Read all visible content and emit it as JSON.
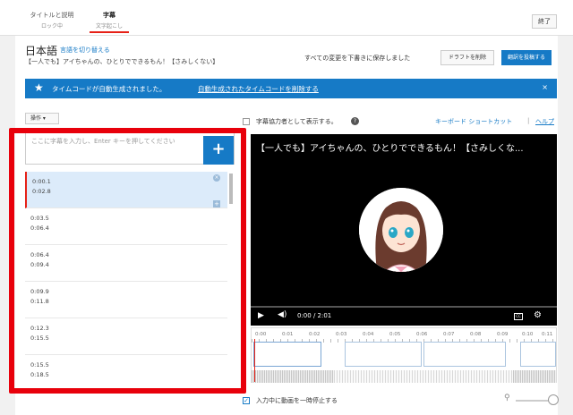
{
  "tabs": [
    {
      "label": "タイトルと説明",
      "sub": "ロック中"
    },
    {
      "label": "字幕",
      "sub": "文字起こし"
    }
  ],
  "finish_label": "終了",
  "language": {
    "title": "日本語",
    "switch_label": "言語を切り替える"
  },
  "video_title": "【一人でも】アイちゃんの、ひとりでできるもん！【さみしくない】",
  "save_status": "すべての変更を下書きに保存しました",
  "buttons": {
    "discard_draft": "ドラフトを削除",
    "publish": "翻訳を投稿する"
  },
  "banner": {
    "text": "タイムコードが自動生成されました。",
    "link": "自動生成されたタイムコードを削除する",
    "close": "×"
  },
  "ops_label": "操作 ▾",
  "caption_input": {
    "placeholder": "ここに字幕を入力し、Enter キーを押してください",
    "add_label": "+"
  },
  "captions": [
    {
      "start": "0:00.1",
      "end": "0:02.8"
    },
    {
      "start": "0:03.5",
      "end": "0:06.4"
    },
    {
      "start": "0:06.4",
      "end": "0:09.4"
    },
    {
      "start": "0:09.9",
      "end": "0:11.8"
    },
    {
      "start": "0:12.3",
      "end": "0:15.5"
    },
    {
      "start": "0:15.5",
      "end": "0:18.5"
    }
  ],
  "selected_caption_index": 0,
  "contributor_checkbox_label": "字幕協力者として表示する。",
  "keyboard_shortcuts_label": "キーボード ショートカット",
  "help_label": "ヘルプ",
  "player": {
    "caption_text": "【一人でも】アイちゃんの、ひとりでできるもん！【さみしくな...",
    "time": "0:00 / 2:01",
    "progress": 0
  },
  "timeline": {
    "ticks": [
      "0:00",
      "0:01",
      "0:02",
      "0:03",
      "0:04",
      "0:05",
      "0:06",
      "0:07",
      "0:08",
      "0:09",
      "0:10",
      "0:11"
    ]
  },
  "pause_checkbox_label": "入力中に動画を一時停止する",
  "colors": {
    "accent": "#167ac6",
    "highlight": "#e8000b",
    "brand_red": "#e62117"
  }
}
